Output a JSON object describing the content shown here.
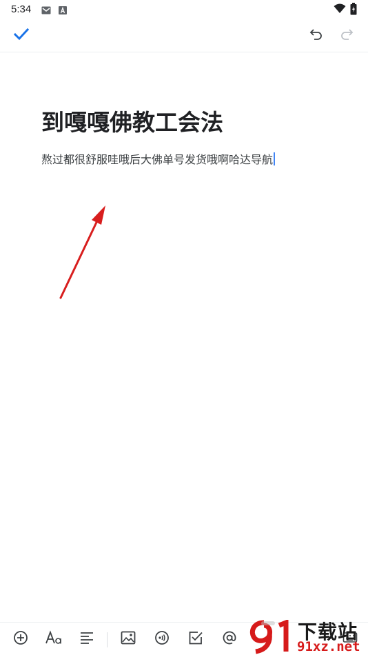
{
  "status_bar": {
    "time": "5:34",
    "icons": [
      "gmail-icon",
      "text-a-icon",
      "wifi-icon",
      "battery-icon"
    ]
  },
  "app_bar": {
    "icons": [
      "check-icon",
      "undo-icon",
      "redo-icon"
    ],
    "accent_color": "#1a73e8"
  },
  "document": {
    "title": "到嘎嘎佛教工会法",
    "body": "熬过都很舒服哇哦后大佛单号发货哦啊哈达导航"
  },
  "annotation": {
    "arrow_color": "#d81e1e"
  },
  "toolbar": {
    "icons": [
      "add-circle-icon",
      "text-format-icon",
      "align-left-icon",
      "image-icon",
      "audio-icon",
      "checkbox-icon",
      "mention-icon",
      "keyboard-icon"
    ]
  },
  "watermark": {
    "title": "下载站",
    "url": "91xz.net",
    "logo_text": "9",
    "brand_color": "#d61a1a"
  }
}
